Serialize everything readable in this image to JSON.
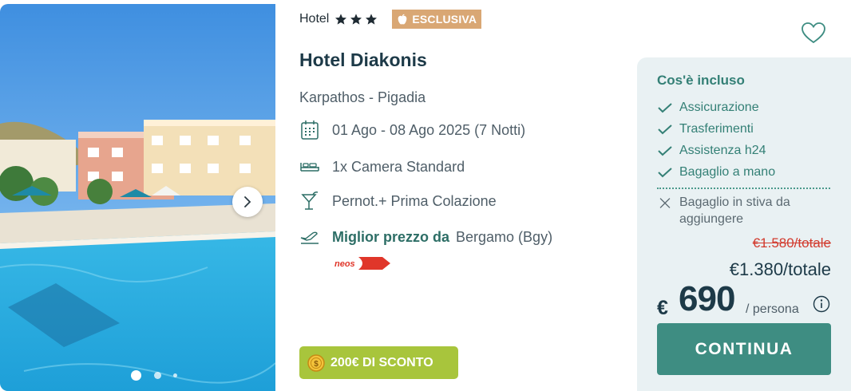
{
  "card": {
    "hotel_type": "Hotel",
    "stars": 3,
    "badge": "ESCLUSIVA",
    "name": "Hotel Diakonis",
    "location": "Karpathos - Pigadia",
    "dates": "01 Ago - 08 Ago 2025 (7 Notti)",
    "room": "1x Camera Standard",
    "board": "Pernot.+ Prima Colazione",
    "best_price_label": "Miglior prezzo da",
    "departure": "Bergamo (Bgy)",
    "airline": "neos",
    "discount": "200€ DI SCONTO",
    "carousel": {
      "active_index": 0,
      "dot_count": 3
    }
  },
  "included": {
    "title": "Cos'è incluso",
    "items": [
      "Assicurazione",
      "Trasferimenti",
      "Assistenza h24",
      "Bagaglio a mano"
    ],
    "excluded": [
      "Bagaglio in stiva da",
      "aggiungere"
    ]
  },
  "price": {
    "old_total": "€1.580/totale",
    "total": "€1.380/totale",
    "currency": "€",
    "per_person": "690",
    "per_person_label": "/ persona",
    "cta": "CONTINUA"
  },
  "icons": {
    "star": "star-icon",
    "apple": "apple-icon",
    "calendar": "calendar-icon",
    "bed": "bed-icon",
    "cocktail": "cocktail-icon",
    "plane": "plane-icon",
    "coin": "coin-icon",
    "heart": "heart-icon",
    "check": "check-icon",
    "cross": "cross-icon",
    "info": "info-icon",
    "chevron": "chevron-right-icon"
  },
  "colors": {
    "accent": "#3e8d82",
    "title": "#1d3a48",
    "badge": "#d9a774",
    "discount": "#a8c53c",
    "old_price": "#d23b2e",
    "panel": "#e9f1f3"
  }
}
